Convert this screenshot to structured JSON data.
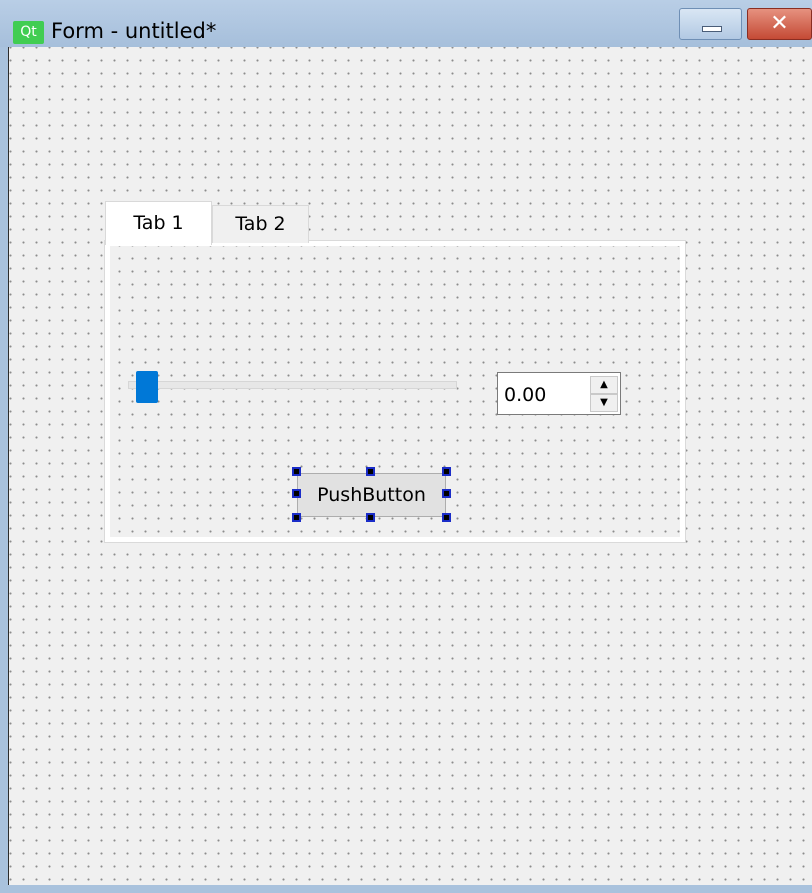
{
  "window": {
    "app_icon_text": "Qt",
    "title": "Form - untitled*",
    "minimize_label": "",
    "close_label": "✕"
  },
  "form": {
    "tabs": [
      {
        "label": "Tab 1",
        "active": true
      },
      {
        "label": "Tab 2",
        "active": false
      }
    ],
    "slider": {
      "value": 0
    },
    "spinbox": {
      "value": "0.00",
      "up_glyph": "▲",
      "down_glyph": "▼"
    },
    "push_button": {
      "label": "PushButton",
      "selected": true
    }
  },
  "colors": {
    "accent": "#0078d7",
    "titlebar": "#a9c2dd",
    "canvas": "#f0f0f0",
    "qt_green": "#41cd52",
    "close_red": "#c44a35",
    "selection_handle": "#000000"
  }
}
